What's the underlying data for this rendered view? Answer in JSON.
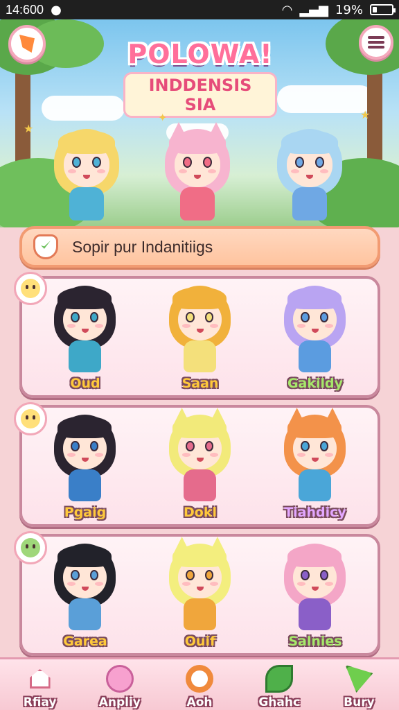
{
  "status": {
    "time": "14:600",
    "battery": "19%",
    "battery_level": 0.19
  },
  "header": {
    "title_line1": "POLOWA!",
    "title_line2": "INDDENSIS SIA",
    "menu_icon": "hamburger-menu-icon",
    "left_icon": "flag-badge-icon"
  },
  "search": {
    "text": "Sopir pur Indanitiigs"
  },
  "panels": [
    {
      "characters": [
        {
          "name": "Oud",
          "hair": "#2b2430",
          "outfit": "#3ea8c8"
        },
        {
          "name": "Saan",
          "hair": "#f1b13b",
          "outfit": "#f4e07b"
        },
        {
          "name": "Gakildy",
          "hair": "#b9a4f2",
          "outfit": "#5b9ce0"
        }
      ]
    },
    {
      "characters": [
        {
          "name": "Pgaig",
          "hair": "#2b2430",
          "outfit": "#3a7fc8"
        },
        {
          "name": "Dokl",
          "hair": "#f2ea7a",
          "outfit": "#e56b8c"
        },
        {
          "name": "Tiahdicy",
          "hair": "#f3924a",
          "outfit": "#4aa6d8"
        }
      ]
    },
    {
      "characters": [
        {
          "name": "Garea",
          "hair": "#22222a",
          "outfit": "#5a9fd8"
        },
        {
          "name": "Ouif",
          "hair": "#f3ee7e",
          "outfit": "#f0a63c"
        },
        {
          "name": "Salnies",
          "hair": "#f4a6c7",
          "outfit": "#8a5fc8"
        }
      ]
    }
  ],
  "hero": [
    {
      "hair": "#f6d76a",
      "outfit": "#4fb2d6"
    },
    {
      "hair": "#f7b4cf",
      "outfit": "#f06d86"
    },
    {
      "hair": "#a9d6f2",
      "outfit": "#6fa8e4"
    }
  ],
  "nav": [
    {
      "label": "Rfiay",
      "icon": "home-icon"
    },
    {
      "label": "Anpliy",
      "icon": "cat-face-icon"
    },
    {
      "label": "Aoh",
      "icon": "ring-icon"
    },
    {
      "label": "Ghahc",
      "icon": "leaf-icon"
    },
    {
      "label": "Bury",
      "icon": "arrow-flag-icon"
    }
  ]
}
